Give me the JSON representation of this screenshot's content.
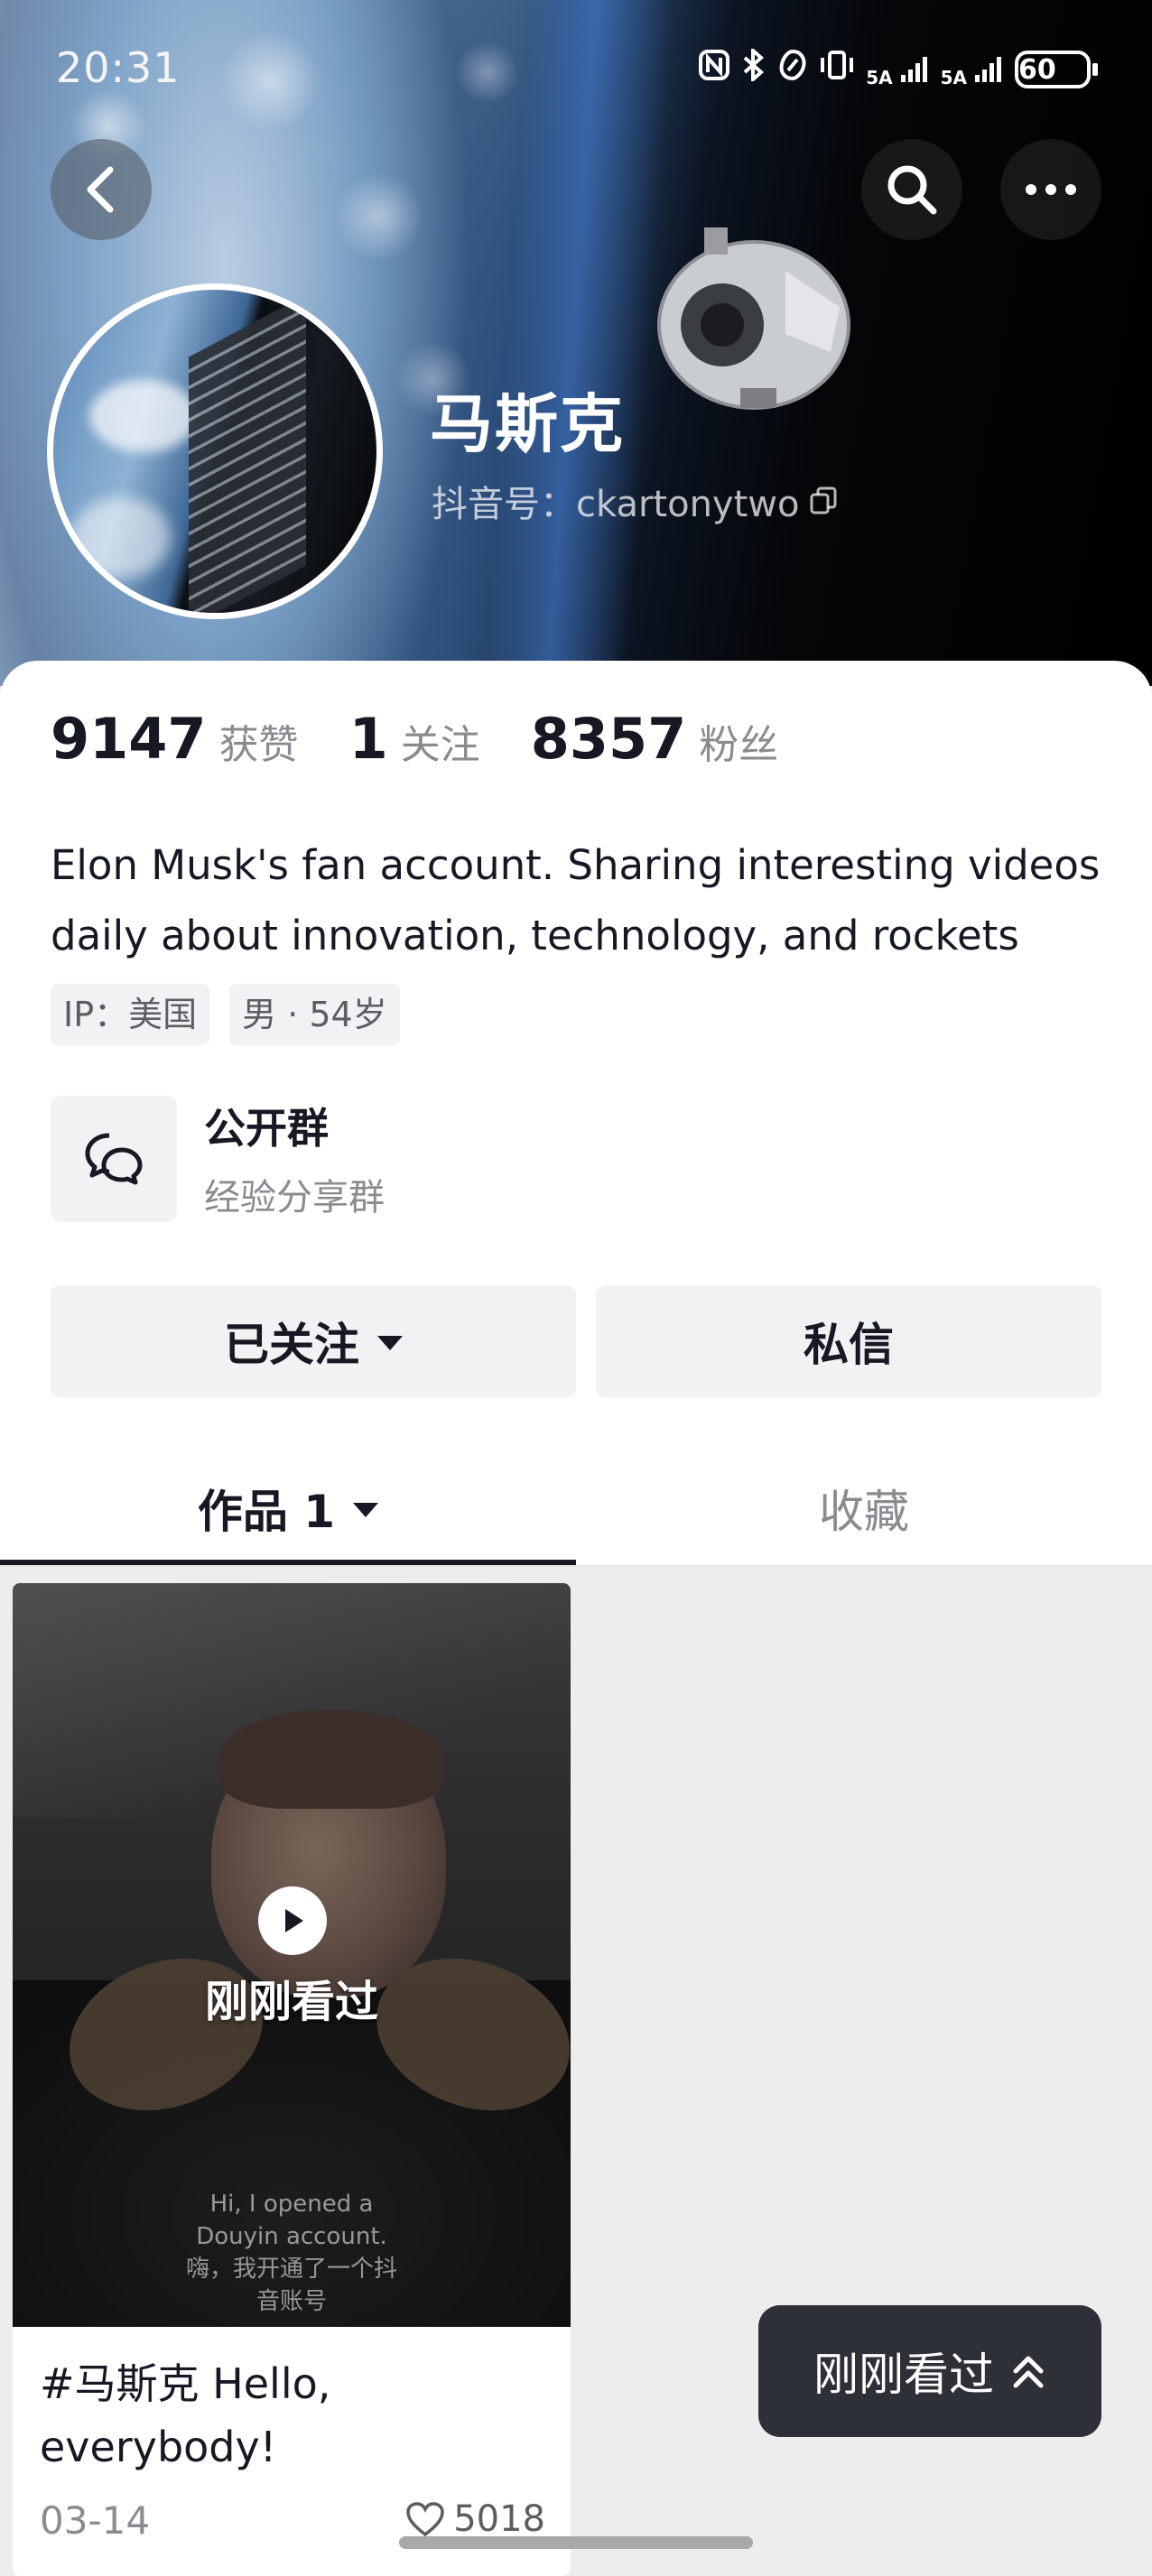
{
  "status_bar": {
    "time": "20:31",
    "network_1": "5A",
    "network_2": "5A",
    "battery": "60"
  },
  "header": {
    "name": "马斯克",
    "douyin_id": "抖音号：ckartonytwo"
  },
  "stats": [
    {
      "value": "9147",
      "label": "获赞"
    },
    {
      "value": "1",
      "label": "关注"
    },
    {
      "value": "8357",
      "label": "粉丝"
    }
  ],
  "bio": "Elon Musk's fan account. Sharing interesting videos daily about innovation, technology, and rockets",
  "tags": [
    "IP：美国",
    "男 · 54岁"
  ],
  "group": {
    "title": "公开群",
    "subtitle": "经验分享群"
  },
  "actions": {
    "follow_label": "已关注",
    "message_label": "私信"
  },
  "tabs": {
    "works_label": "作品 1",
    "favorites_label": "收藏"
  },
  "video": {
    "overlay_label": "刚刚看过",
    "subtitle_en_1": "Hi, I opened a",
    "subtitle_en_2": "Douyin account.",
    "subtitle_cn_1": "嗨，我开通了一个抖",
    "subtitle_cn_2": "音账号",
    "title": "#马斯克 Hello, everybody!",
    "date": "03-14",
    "likes": "5018"
  },
  "floating_button": {
    "label": "刚刚看过"
  }
}
